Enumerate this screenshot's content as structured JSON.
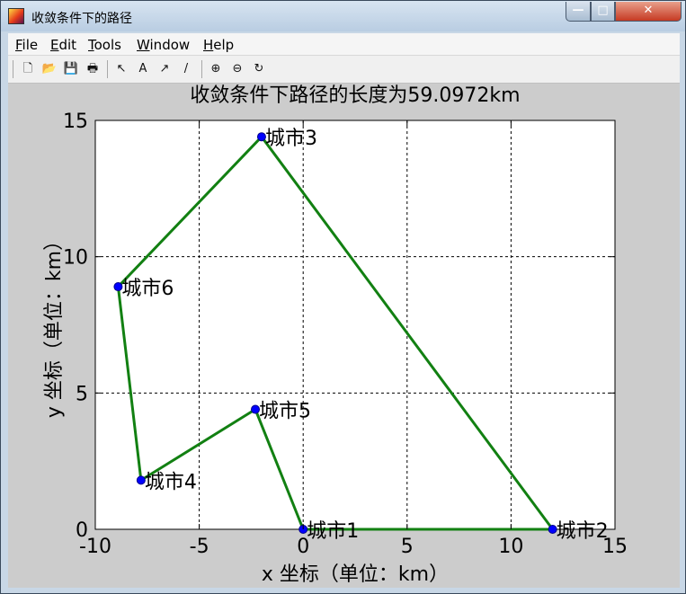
{
  "window": {
    "title": "收敛条件下的路径",
    "controls": {
      "minimize": "—",
      "maximize": "□",
      "close": "✕"
    }
  },
  "menu": [
    {
      "label": "File"
    },
    {
      "label": "Edit"
    },
    {
      "label": "Tools"
    },
    {
      "label": "Window"
    },
    {
      "label": "Help"
    }
  ],
  "toolbar": [
    {
      "name": "new-figure-icon",
      "glyph": "🗋"
    },
    {
      "name": "open-file-icon",
      "glyph": "📂"
    },
    {
      "name": "save-icon",
      "glyph": "💾"
    },
    {
      "name": "print-icon",
      "glyph": "🖶"
    },
    {
      "name": "edit-plot-arrow-icon",
      "glyph": "↖"
    },
    {
      "name": "insert-text-icon",
      "glyph": "A"
    },
    {
      "name": "insert-arrow-icon",
      "glyph": "↗"
    },
    {
      "name": "insert-line-icon",
      "glyph": "/"
    },
    {
      "name": "zoom-in-icon",
      "glyph": "⊕"
    },
    {
      "name": "zoom-out-icon",
      "glyph": "⊖"
    },
    {
      "name": "rotate-3d-icon",
      "glyph": "↻"
    }
  ],
  "chart_data": {
    "type": "line",
    "title": "收敛条件下路径的长度为59.0972km",
    "xlabel": "x 坐标（单位：km）",
    "ylabel": "y 坐标（单位：km）",
    "xlim": [
      -10,
      15
    ],
    "ylim": [
      0,
      15
    ],
    "xticks": [
      -10,
      -5,
      0,
      5,
      10,
      15
    ],
    "yticks": [
      0,
      5,
      10,
      15
    ],
    "grid": true,
    "line_color": "#128012",
    "marker_color": "#0000ff",
    "cities": [
      {
        "label": "城市1",
        "x": 0.0,
        "y": 0.0
      },
      {
        "label": "城市2",
        "x": 12.0,
        "y": 0.0
      },
      {
        "label": "城市3",
        "x": -2.0,
        "y": 14.4
      },
      {
        "label": "城市4",
        "x": -7.8,
        "y": 1.8
      },
      {
        "label": "城市5",
        "x": -2.3,
        "y": 4.4
      },
      {
        "label": "城市6",
        "x": -8.9,
        "y": 8.9
      }
    ],
    "route_order": [
      1,
      2,
      3,
      6,
      4,
      5,
      1
    ]
  }
}
